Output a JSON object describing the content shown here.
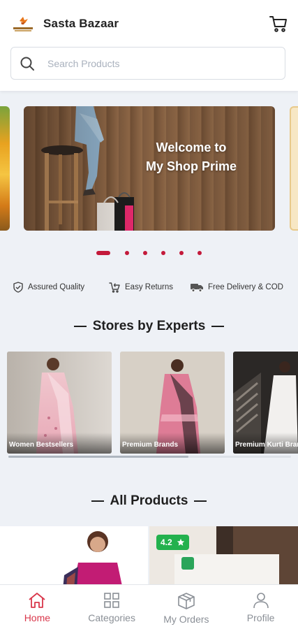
{
  "header": {
    "app_title": "Sasta Bazaar",
    "search_placeholder": "Search Products",
    "cart_icon": "cart-icon"
  },
  "banner": {
    "line1": "Welcome to",
    "line2": "My Shop Prime",
    "slide_count": 6,
    "active_index": 0,
    "accent": "#c3193a"
  },
  "features": [
    {
      "icon": "shield-check-icon",
      "label": "Assured Quality"
    },
    {
      "icon": "return-cart-icon",
      "label": "Easy Returns"
    },
    {
      "icon": "truck-icon",
      "label": "Free Delivery & COD"
    }
  ],
  "stores_section": {
    "title": "Stores by Experts",
    "stores": [
      {
        "label": "Women Bestsellers"
      },
      {
        "label": "Premium Brands"
      },
      {
        "label": "Premium Kurti Brands"
      }
    ]
  },
  "products_section": {
    "title": "All Products",
    "products": [
      {
        "rating": ""
      },
      {
        "rating": "4.2"
      }
    ]
  },
  "bottom_nav": {
    "items": [
      {
        "label": "Home",
        "icon": "home-icon",
        "active": true
      },
      {
        "label": "Categories",
        "icon": "grid-icon",
        "active": false
      },
      {
        "label": "My Orders",
        "icon": "box-icon",
        "active": false
      },
      {
        "label": "Profile",
        "icon": "person-icon",
        "active": false
      }
    ],
    "active_color": "#d9374b",
    "inactive_color": "#8a8f96"
  }
}
